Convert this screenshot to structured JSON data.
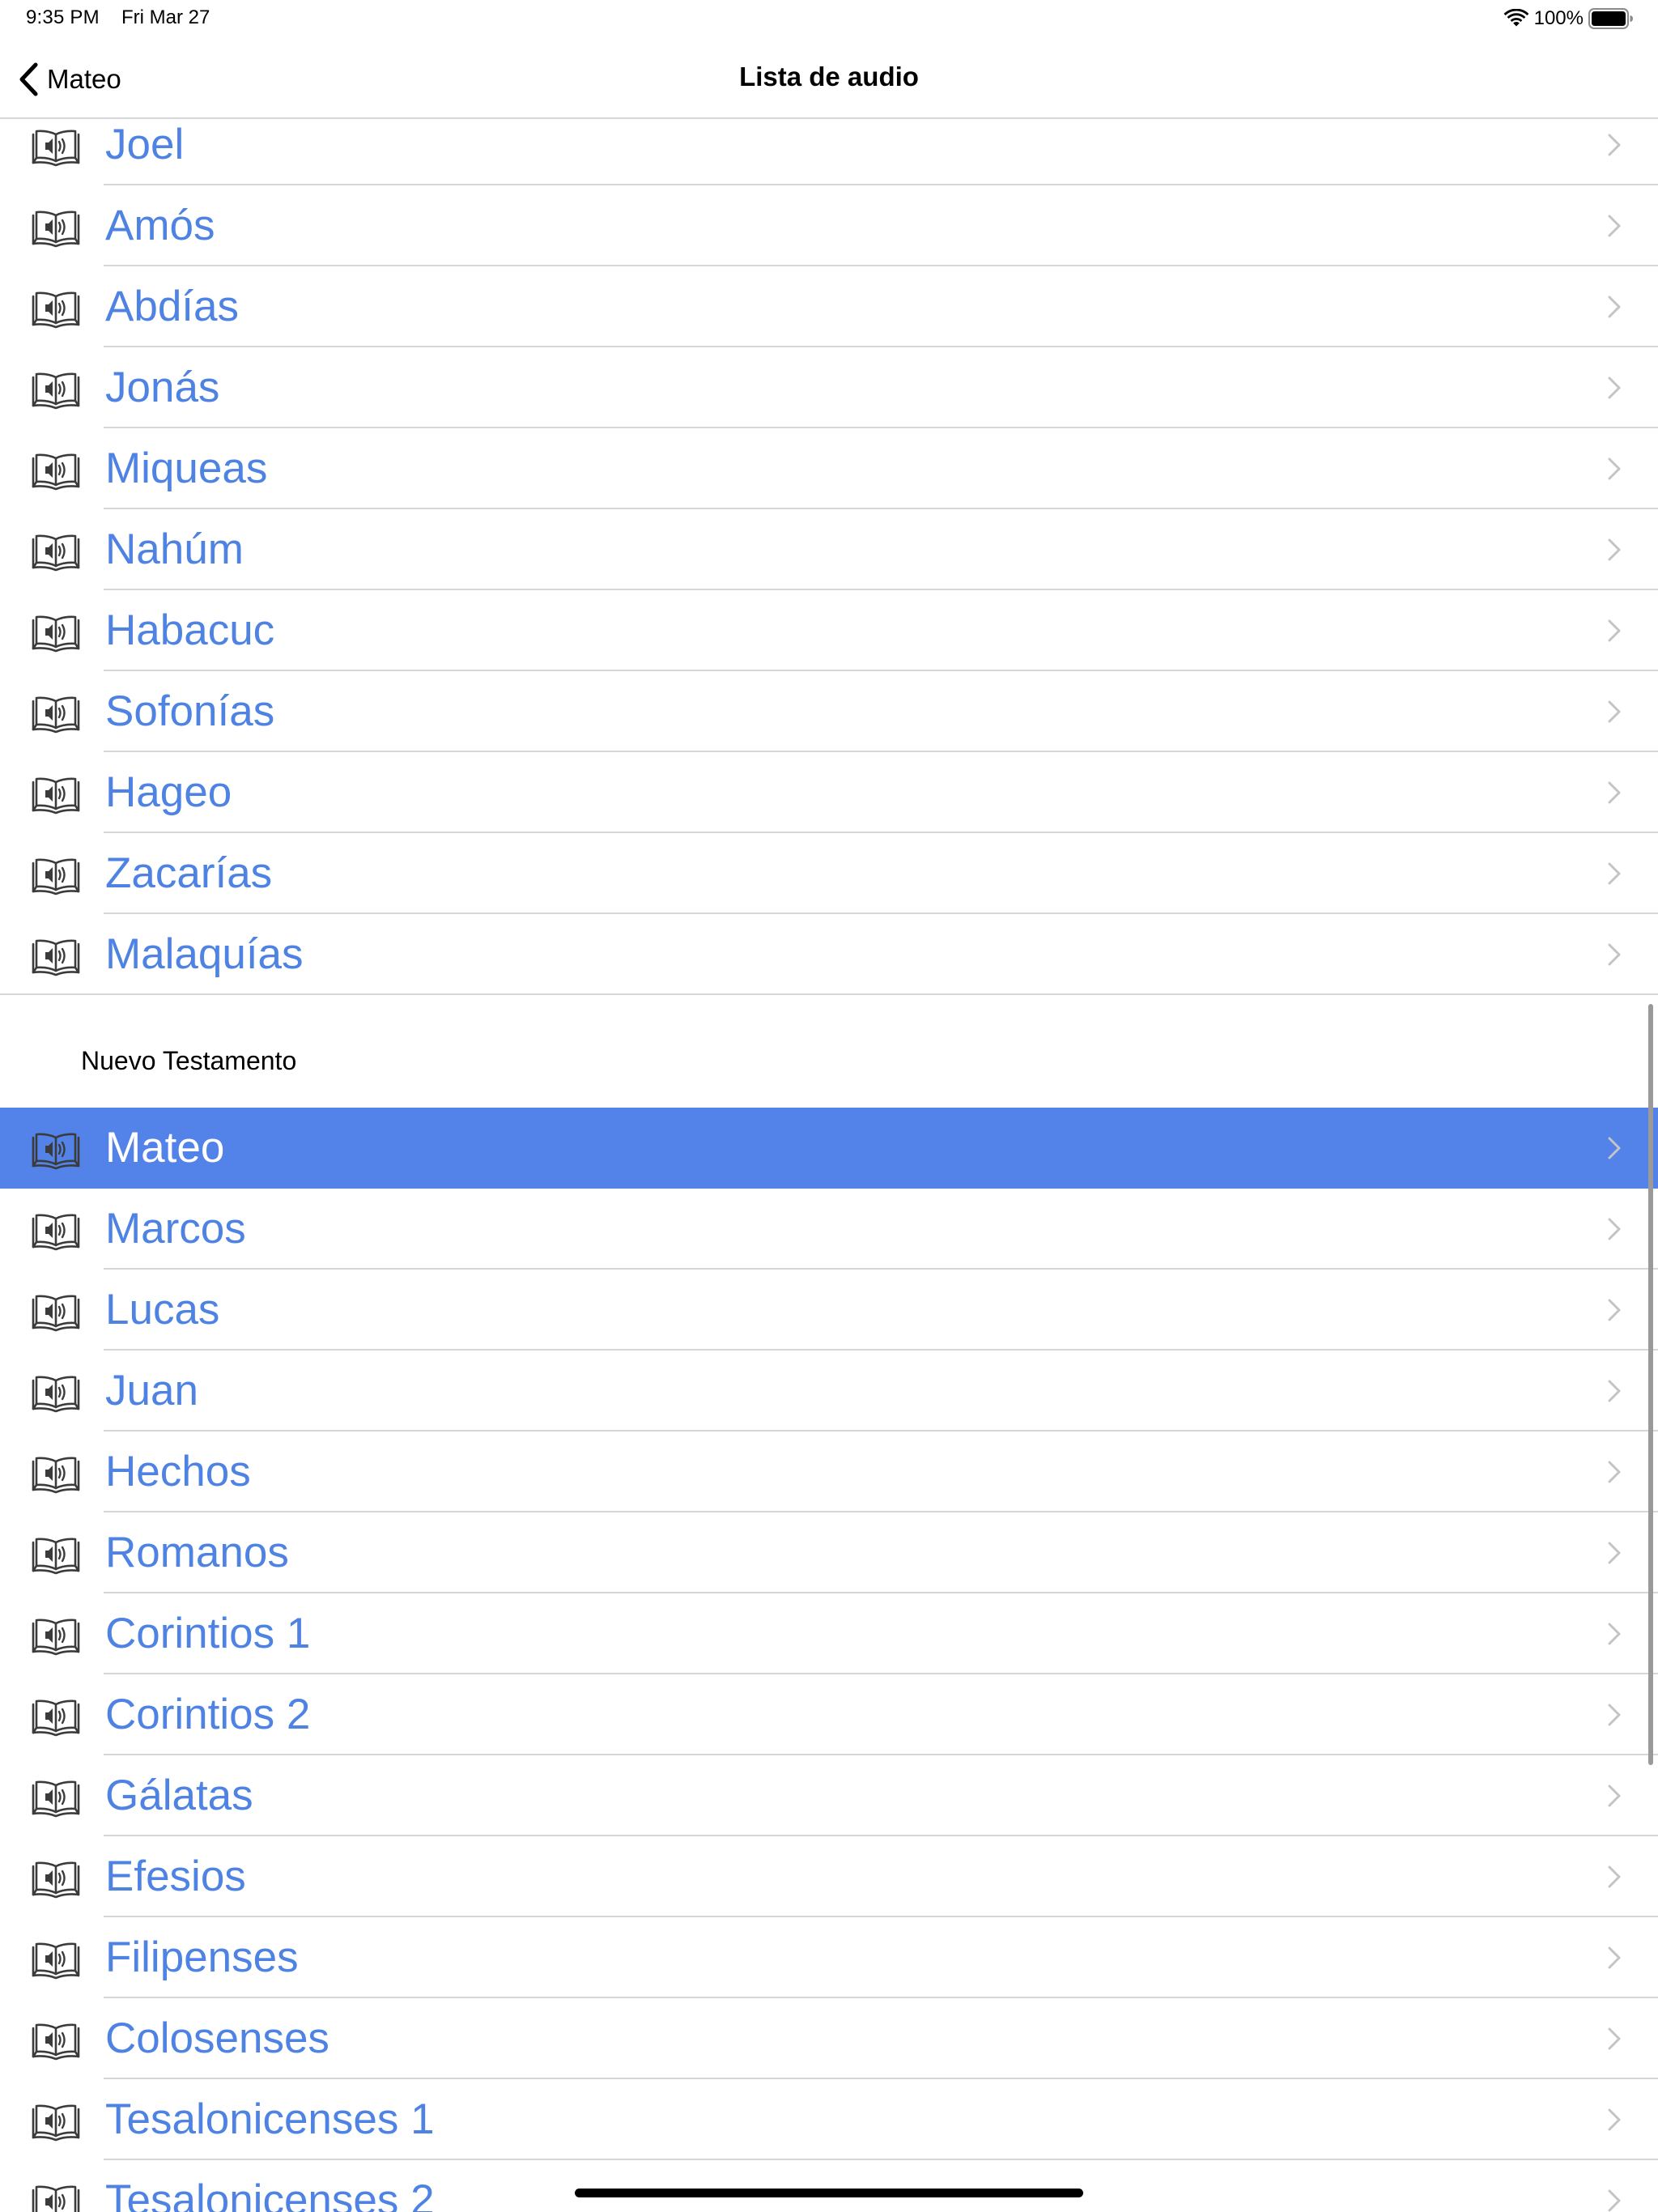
{
  "status_bar": {
    "time": "9:35 PM",
    "date": "Fri Mar 27",
    "battery": "100%"
  },
  "nav": {
    "back_label": "Mateo",
    "title": "Lista de audio"
  },
  "sections": [
    {
      "header": "",
      "items": [
        {
          "label": "Joel"
        },
        {
          "label": "Amós"
        },
        {
          "label": "Abdías"
        },
        {
          "label": "Jonás"
        },
        {
          "label": "Miqueas"
        },
        {
          "label": "Nahúm"
        },
        {
          "label": "Habacuc"
        },
        {
          "label": "Sofonías"
        },
        {
          "label": "Hageo"
        },
        {
          "label": "Zacarías"
        },
        {
          "label": "Malaquías"
        }
      ]
    },
    {
      "header": "Nuevo Testamento",
      "items": [
        {
          "label": "Mateo",
          "selected": true
        },
        {
          "label": "Marcos"
        },
        {
          "label": "Lucas"
        },
        {
          "label": "Juan"
        },
        {
          "label": "Hechos"
        },
        {
          "label": "Romanos"
        },
        {
          "label": "Corintios 1"
        },
        {
          "label": "Corintios 2"
        },
        {
          "label": "Gálatas"
        },
        {
          "label": "Efesios"
        },
        {
          "label": "Filipenses"
        },
        {
          "label": "Colosenses"
        },
        {
          "label": "Tesalonicenses 1"
        },
        {
          "label": "Tesalonicenses 2"
        }
      ]
    }
  ],
  "colors": {
    "accent": "#4e82e3",
    "selected_row": "#5383e8",
    "separator": "#d6d6d8"
  },
  "icons": {
    "row": "audio-book-icon",
    "disclosure": "chevron-right-icon",
    "back": "chevron-left-icon"
  }
}
